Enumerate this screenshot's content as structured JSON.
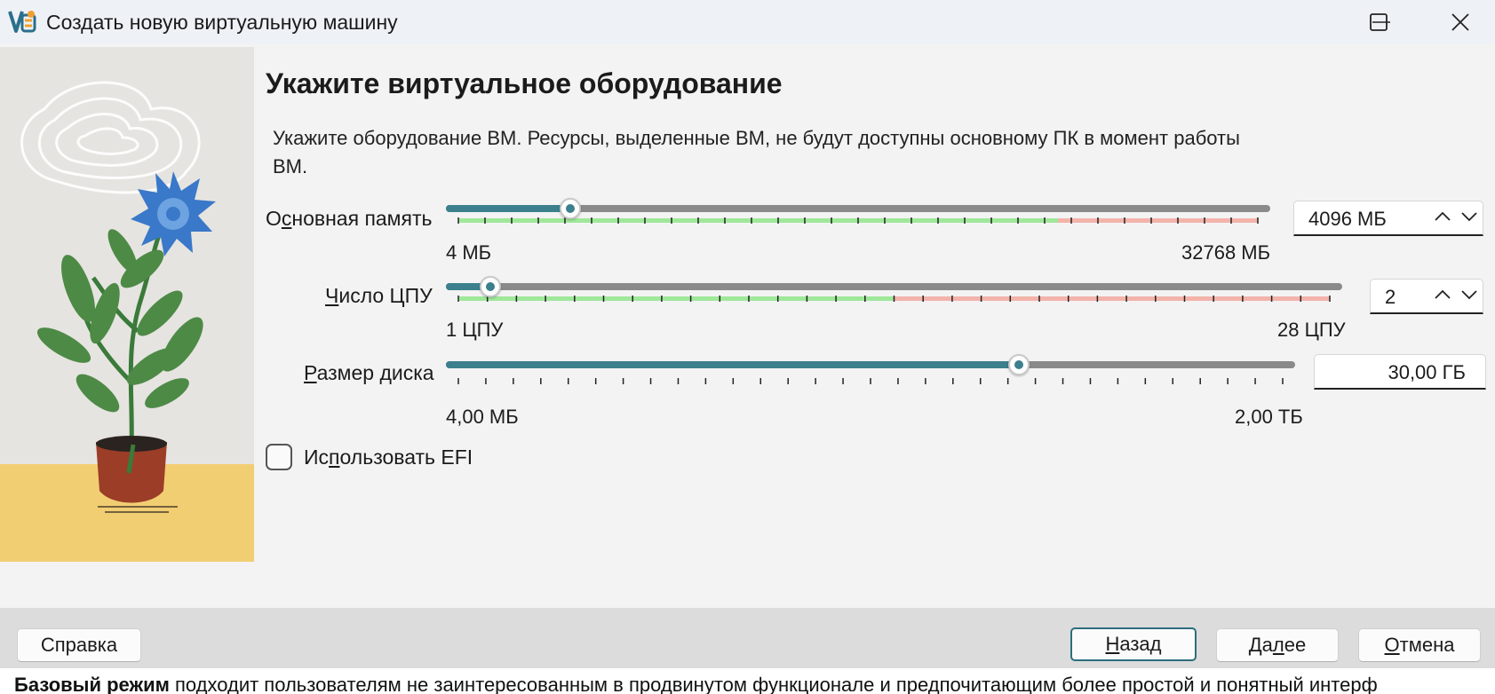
{
  "window": {
    "title": "Создать новую виртуальную машину",
    "controls": [
      "minimize",
      "maximize",
      "close"
    ]
  },
  "page": {
    "heading": "Укажите виртуальное оборудование",
    "description": "Укажите оборудование ВМ. Ресурсы, выделенные ВМ, не будут доступны основному ПК в момент работы ВМ."
  },
  "memory": {
    "label_pre": "О",
    "label_accel": "с",
    "label_post": "новная память",
    "min_label": "4 МБ",
    "max_label": "32768 МБ",
    "value": "4096 МБ",
    "fraction": 0.14,
    "recommended_fraction": 0.75
  },
  "cpu": {
    "label_accel": "Ч",
    "label_post": "исло ЦПУ",
    "min_label": "1 ЦПУ",
    "max_label": "28 ЦПУ",
    "value": "2",
    "fraction": 0.037,
    "recommended_fraction": 0.5
  },
  "disk": {
    "label_accel": "Р",
    "label_post": "азмер диска",
    "min_label": "4,00 МБ",
    "max_label": "2,00 ТБ",
    "value": "30,00 ГБ",
    "fraction": 0.68
  },
  "efi": {
    "label_pre": "Ис",
    "label_accel": "п",
    "label_post": "ользовать EFI",
    "checked": false
  },
  "buttons": {
    "help": "Справка",
    "back_accel": "Н",
    "back_post": "азад",
    "next_pre": "Да",
    "next_accel": "л",
    "next_post": "ее",
    "cancel_accel": "О",
    "cancel_post": "тмена"
  },
  "background_page": {
    "bold_text": "Базовый режим",
    "text": " подходит пользователям не заинтересованным в продвинутом функционале и предпочитающим более простой и понятный интерф"
  },
  "colors": {
    "accent": "#3c7f8d",
    "track": "#8a8a8a",
    "range_ok": "#9fe89a",
    "range_warn": "#f3b3aa"
  }
}
